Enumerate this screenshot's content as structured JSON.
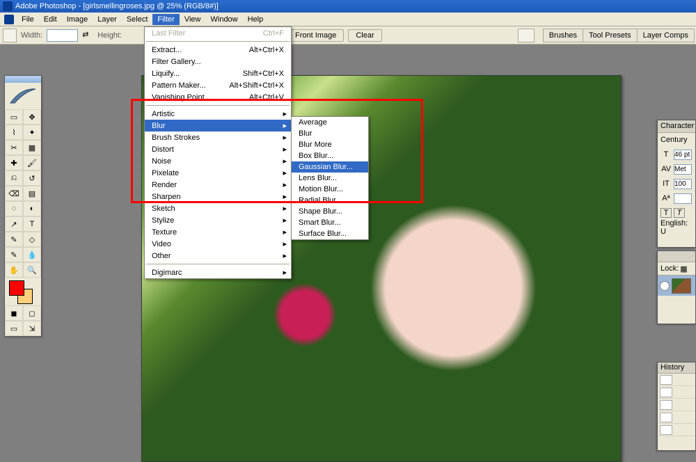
{
  "title": "Adobe Photoshop - [girlsmellingroses.jpg @ 25% (RGB/8#)]",
  "menubar": [
    "File",
    "Edit",
    "Image",
    "Layer",
    "Select",
    "Filter",
    "View",
    "Window",
    "Help"
  ],
  "activeMenu": "Filter",
  "options": {
    "widthLabel": "Width:",
    "heightLabel": "Height:",
    "frontImage": "Front Image",
    "clear": "Clear",
    "tabs": [
      "Brushes",
      "Tool Presets",
      "Layer Comps"
    ]
  },
  "filterMenu": {
    "lastFilter": {
      "label": "Last Filter",
      "shortcut": "Ctrl+F",
      "disabled": true
    },
    "items1": [
      {
        "label": "Extract...",
        "shortcut": "Alt+Ctrl+X"
      },
      {
        "label": "Filter Gallery...",
        "shortcut": ""
      },
      {
        "label": "Liquify...",
        "shortcut": "Shift+Ctrl+X"
      },
      {
        "label": "Pattern Maker...",
        "shortcut": "Alt+Shift+Ctrl+X"
      },
      {
        "label": "Vanishing Point...",
        "shortcut": "Alt+Ctrl+V"
      }
    ],
    "items2": [
      "Artistic",
      "Blur",
      "Brush Strokes",
      "Distort",
      "Noise",
      "Pixelate",
      "Render",
      "Sharpen",
      "Sketch",
      "Stylize",
      "Texture",
      "Video",
      "Other"
    ],
    "highlighted2": "Blur",
    "items3": [
      "Digimarc"
    ]
  },
  "blurSubmenu": {
    "items": [
      "Average",
      "Blur",
      "Blur More",
      "Box Blur...",
      "Gaussian Blur...",
      "Lens Blur...",
      "Motion Blur...",
      "Radial Blur...",
      "Shape Blur...",
      "Smart Blur...",
      "Surface Blur..."
    ],
    "highlighted": "Gaussian Blur..."
  },
  "charPanel": {
    "title": "Character",
    "font": "Century",
    "size": "46 pt",
    "tracking": "Met",
    "vscale": "100",
    "baseline": "",
    "language": "English: U"
  },
  "layersPanel": {
    "lockLabel": "Lock:"
  },
  "historyPanel": {
    "title": "History"
  }
}
